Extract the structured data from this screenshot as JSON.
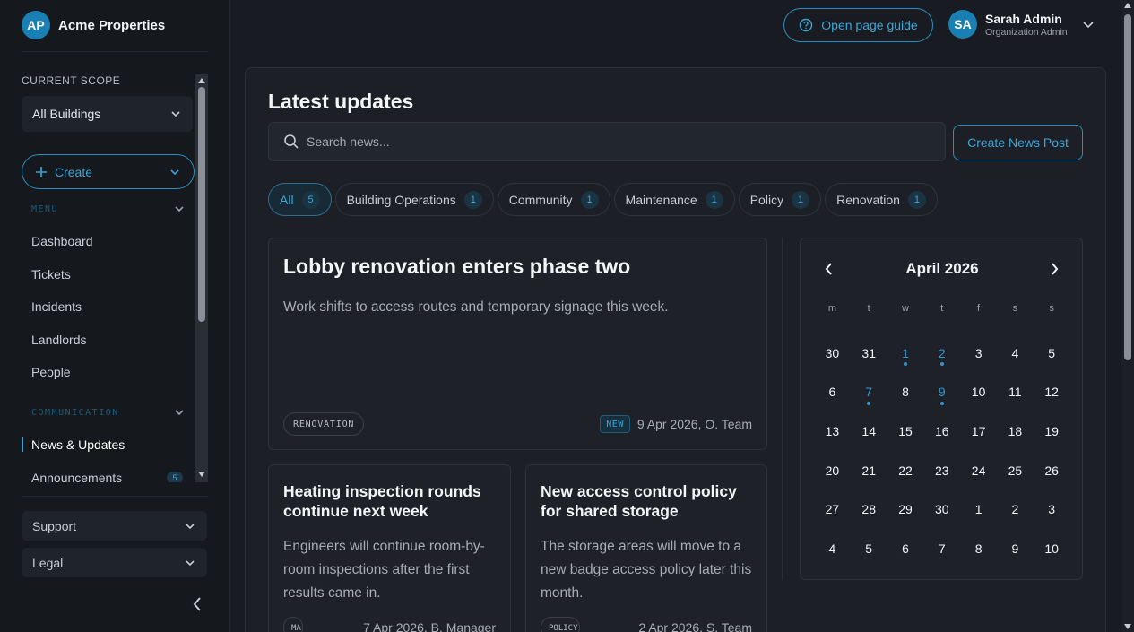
{
  "brand": {
    "initials": "AP",
    "name": "Acme Properties"
  },
  "sidebar": {
    "scope_label": "CURRENT SCOPE",
    "scope_value": "All Buildings",
    "create_label": "Create",
    "menu_label": "MENU",
    "menu_items": [
      "Dashboard",
      "Tickets",
      "Incidents",
      "Landlords",
      "People"
    ],
    "communication_label": "COMMUNICATION",
    "communication_items": [
      {
        "label": "News & Updates",
        "active": true
      },
      {
        "label": "Announcements",
        "badge": "5"
      }
    ],
    "support_label": "Support",
    "legal_label": "Legal"
  },
  "header": {
    "guide_label": "Open page guide",
    "user_initials": "SA",
    "user_name": "Sarah Admin",
    "user_role": "Organization Admin"
  },
  "main": {
    "title": "Latest updates",
    "search_placeholder": "Search news...",
    "create_news_label": "Create News Post",
    "filters": [
      {
        "label": "All",
        "count": "5",
        "active": true
      },
      {
        "label": "Building Operations",
        "count": "1"
      },
      {
        "label": "Community",
        "count": "1"
      },
      {
        "label": "Maintenance",
        "count": "1"
      },
      {
        "label": "Policy",
        "count": "1"
      },
      {
        "label": "Renovation",
        "count": "1"
      }
    ],
    "featured": {
      "title": "Lobby renovation enters phase two",
      "description": "Work shifts to access routes and temporary signage this week.",
      "tag": "RENOVATION",
      "badge": "NEW",
      "meta": "9 Apr 2026,  O. Team"
    },
    "cards": [
      {
        "title": "Heating inspection rounds continue next week",
        "description": "Engineers will continue room-by-room inspections after the first results came in.",
        "tag": "MA",
        "meta": "7 Apr 2026,  B. Manager"
      },
      {
        "title": "New access control policy for shared storage",
        "description": "The storage areas will move to a new badge access policy later this month.",
        "tag": "POLICY",
        "meta": "2 Apr 2026,  S. Team"
      }
    ]
  },
  "calendar": {
    "title": "April 2026",
    "weekdays": [
      "m",
      "t",
      "w",
      "t",
      "f",
      "s",
      "s"
    ],
    "days": [
      {
        "d": "30"
      },
      {
        "d": "31"
      },
      {
        "d": "1",
        "event": true
      },
      {
        "d": "2",
        "event": true
      },
      {
        "d": "3"
      },
      {
        "d": "4"
      },
      {
        "d": "5"
      },
      {
        "d": "6"
      },
      {
        "d": "7",
        "event": true
      },
      {
        "d": "8"
      },
      {
        "d": "9",
        "event": true
      },
      {
        "d": "10"
      },
      {
        "d": "11"
      },
      {
        "d": "12"
      },
      {
        "d": "13"
      },
      {
        "d": "14"
      },
      {
        "d": "15"
      },
      {
        "d": "16"
      },
      {
        "d": "17"
      },
      {
        "d": "18"
      },
      {
        "d": "19"
      },
      {
        "d": "20"
      },
      {
        "d": "21"
      },
      {
        "d": "22"
      },
      {
        "d": "23"
      },
      {
        "d": "24"
      },
      {
        "d": "25"
      },
      {
        "d": "26"
      },
      {
        "d": "27"
      },
      {
        "d": "28"
      },
      {
        "d": "29"
      },
      {
        "d": "30"
      },
      {
        "d": "1"
      },
      {
        "d": "2"
      },
      {
        "d": "3"
      },
      {
        "d": "4"
      },
      {
        "d": "5"
      },
      {
        "d": "6"
      },
      {
        "d": "7"
      },
      {
        "d": "8"
      },
      {
        "d": "9"
      },
      {
        "d": "10"
      }
    ]
  },
  "colors": {
    "accent": "#2f97cc",
    "background": "#181b21",
    "panel": "#1c1f25"
  }
}
